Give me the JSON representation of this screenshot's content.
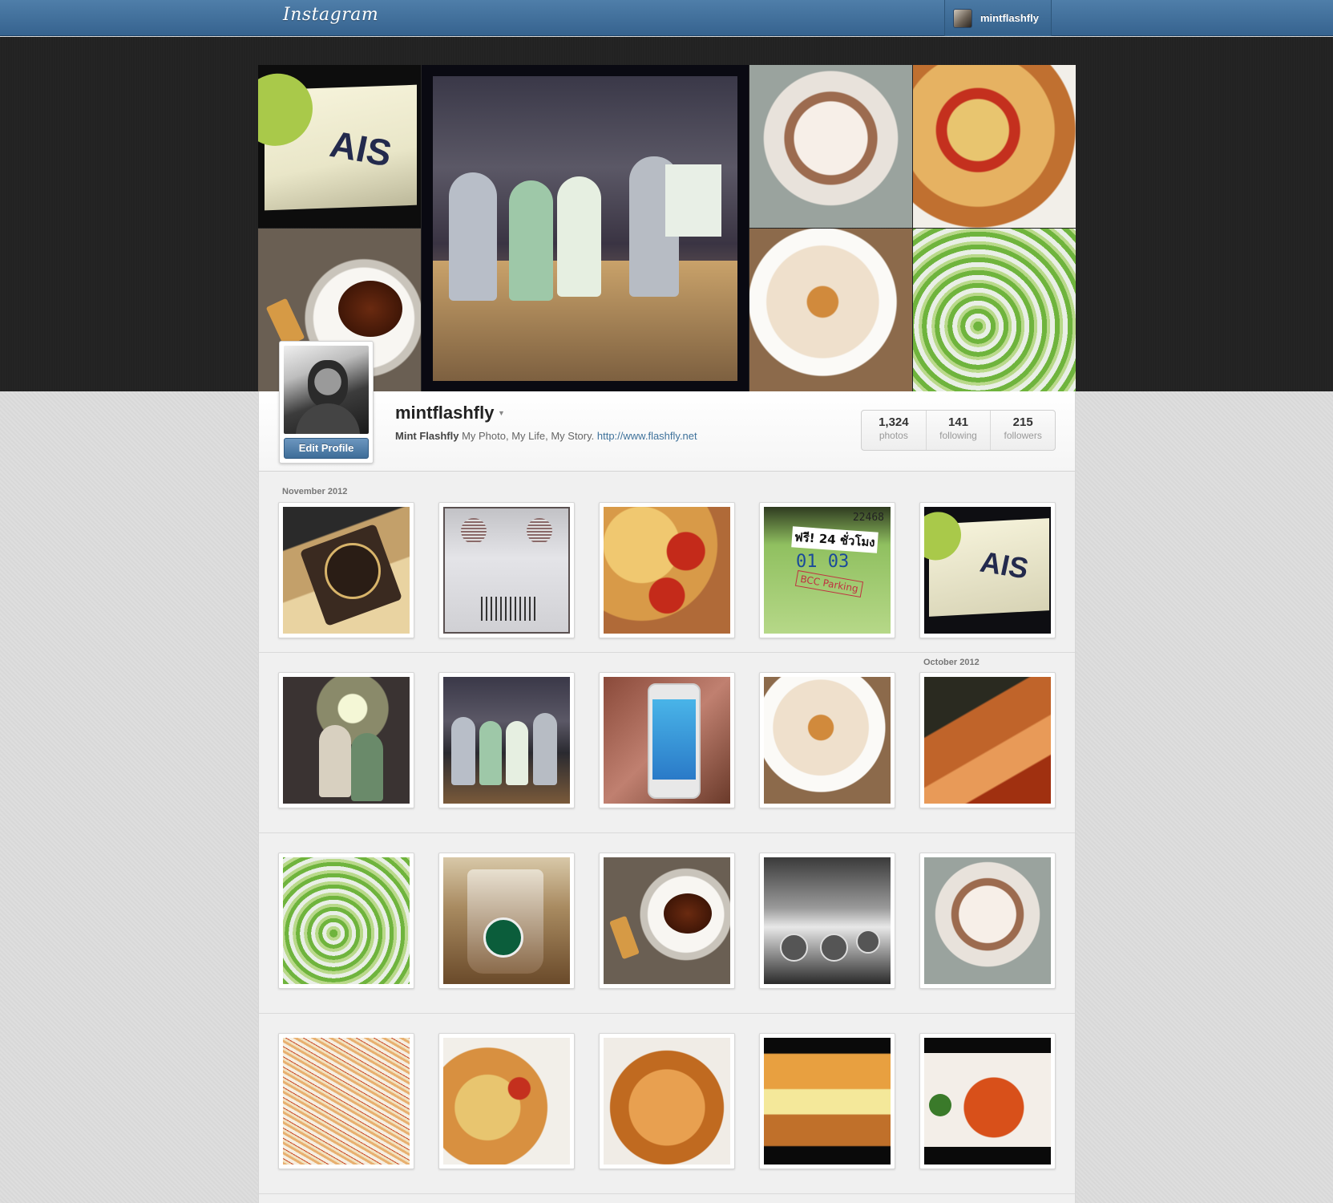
{
  "topbar": {
    "logo": "Instagram",
    "username": "mintflashfly"
  },
  "profile": {
    "username": "mintflashfly",
    "edit_label": "Edit Profile",
    "bio_name": "Mint Flashfly",
    "bio_text": " My Photo, My Life, My Story. ",
    "bio_link": "http://www.flashfly.net"
  },
  "stats": [
    {
      "count": "1,324",
      "label": "photos"
    },
    {
      "count": "141",
      "label": "following"
    },
    {
      "count": "215",
      "label": "followers"
    }
  ],
  "months": {
    "first": "November 2012",
    "second": "October 2012"
  },
  "photo_subjects": [
    [
      "coffee-packet",
      "white-device",
      "pepperoni-pizza",
      "parking-ticket",
      "ais-iphone-banner"
    ],
    [
      "crowd-party",
      "iphone-event",
      "iphone-5-hand",
      "caramel-latte",
      "fried-food"
    ],
    [
      "green-noodles",
      "starbucks-cup",
      "tea-cup-cracker",
      "cafe-tables",
      "whipped-drink"
    ],
    [
      "seafood-pasta",
      "pizza-slice",
      "fried-chicken",
      "sandwich",
      "spicy-pasta"
    ]
  ],
  "ticket_text": {
    "line1": "ฟรี! 24 ชั่วโมง",
    "line2": "01 03",
    "line3": "BCC Parking",
    "number": "22468"
  },
  "banner_text": "AIS"
}
